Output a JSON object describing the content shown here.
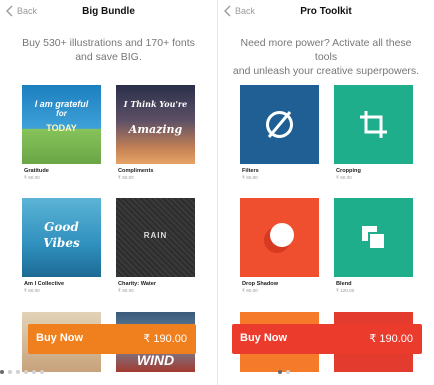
{
  "left_screen": {
    "back_label": "Back",
    "title": "Big Bundle",
    "subtitle_line1": "Buy 530+ illustrations and 170+ fonts",
    "subtitle_line2": "and save BIG.",
    "tiles": [
      {
        "label": "Gratitude",
        "price": "₹ 60.00",
        "art_text1": "I am grateful",
        "art_text2": "for",
        "art_text3": "TODAY"
      },
      {
        "label": "Compliments",
        "price": "₹ 60.00",
        "art_text1": "I Think You're",
        "art_text2": "Amazing"
      },
      {
        "label": "Am I Collective",
        "price": "₹ 60.00",
        "art_text1": "Good",
        "art_text2": "Vibes"
      },
      {
        "label": "Charity: Water",
        "price": "₹ 60.00",
        "art_text1": "RAIN"
      },
      {
        "label": "",
        "price": "",
        "art_text1": ""
      },
      {
        "label": "",
        "price": "",
        "art_text1": "WIND"
      }
    ],
    "buy_label": "Buy Now",
    "buy_price": "₹ 190.00",
    "page_dots": 6,
    "active_dot": 0
  },
  "right_screen": {
    "back_label": "Back",
    "title": "Pro Toolkit",
    "subtitle_line1": "Need more power? Activate all these tools",
    "subtitle_line2": "and unleash your creative superpowers.",
    "tiles": [
      {
        "label": "Filters",
        "price": "₹ 60.00",
        "icon": "filters-icon",
        "color": "#1f5f94"
      },
      {
        "label": "Cropping",
        "price": "₹ 60.00",
        "icon": "crop-icon",
        "color": "#1fae8c"
      },
      {
        "label": "Drop Shadow",
        "price": "₹ 60.00",
        "icon": "drop-shadow-icon",
        "color": "#f04f2f"
      },
      {
        "label": "Blend",
        "price": "₹ 120.00",
        "icon": "blend-icon",
        "color": "#1fae8c"
      },
      {
        "label": "",
        "price": "",
        "icon": "",
        "color": "#f57a2a"
      },
      {
        "label": "",
        "price": "",
        "icon": "",
        "color": "#e33b2e"
      }
    ],
    "buy_label": "Buy Now",
    "buy_price": "₹ 190.00",
    "page_dots": 2,
    "active_dot": 0
  }
}
